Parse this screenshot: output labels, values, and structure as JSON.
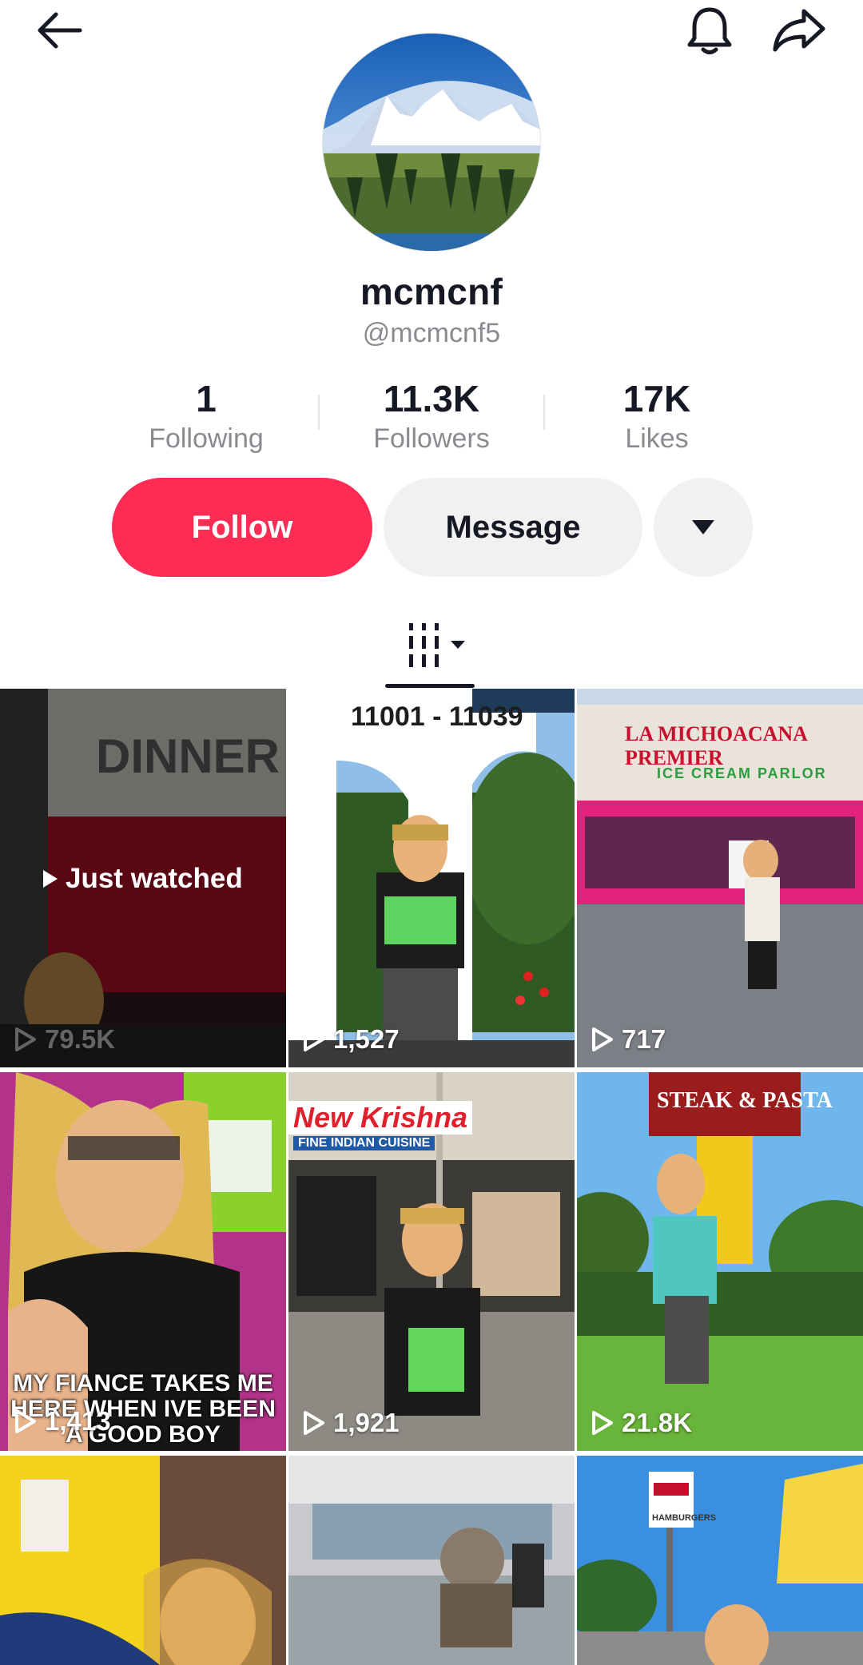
{
  "profile": {
    "display_name": "mcmcnf",
    "handle": "@mcmcnf5"
  },
  "stats": {
    "following_count": "1",
    "following_label": "Following",
    "followers_count": "11.3K",
    "followers_label": "Followers",
    "likes_count": "17K",
    "likes_label": "Likes"
  },
  "actions": {
    "follow_label": "Follow",
    "message_label": "Message"
  },
  "icons": {
    "back": "arrow-left-icon",
    "notifications": "bell-icon",
    "share": "share-arrow-icon",
    "more": "caret-down-icon",
    "tab": "video-grid-icon"
  },
  "colors": {
    "accent": "#fe2c55",
    "secondary_button": "#f1f1f2",
    "muted_text": "#8a8b91"
  },
  "videos": [
    {
      "views": "79.5K",
      "badge": "Just watched",
      "sign_text": "DINNER"
    },
    {
      "views": "1,527",
      "sign_text": "11001 - 11039"
    },
    {
      "views": "717",
      "sign_text": "LA MICHOACANA PREMIER",
      "sign_sub": "ICE CREAM PARLOR"
    },
    {
      "views": "1,413",
      "caption": "MY FIANCE TAKES ME HERE WHEN IVE BEEN A GOOD BOY"
    },
    {
      "views": "1,921",
      "sign_text": "New Krishna",
      "sign_sub": "FINE INDIAN CUISINE"
    },
    {
      "views": "21.8K",
      "sign_text": "STEAK & PASTA"
    },
    {
      "views": ""
    },
    {
      "views": ""
    },
    {
      "views": "",
      "sign_text": "HAMBURGERS"
    }
  ]
}
